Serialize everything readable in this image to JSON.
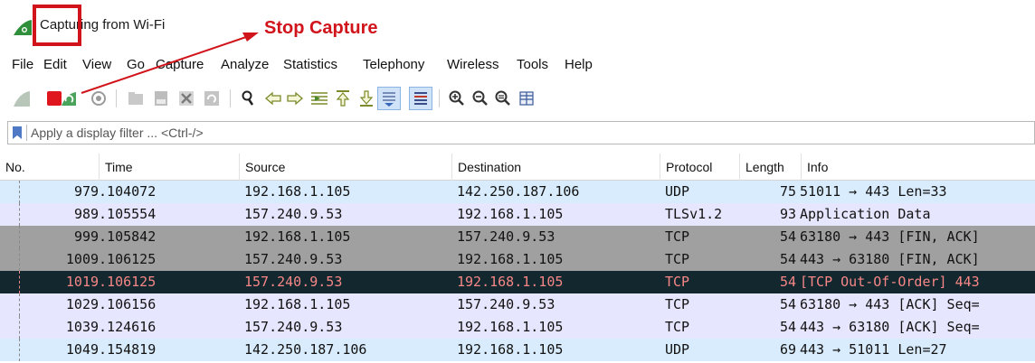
{
  "window": {
    "title": "Capturing from Wi-Fi"
  },
  "annotation": {
    "label": "Stop Capture",
    "color": "#d1141b"
  },
  "menu": [
    "File",
    "Edit",
    "View",
    "Go",
    "Capture",
    "Analyze",
    "Statistics",
    "Telephony",
    "Wireless",
    "Tools",
    "Help"
  ],
  "toolbar": {
    "icons": [
      "start-capture-icon",
      "stop-capture-icon",
      "restart-capture-icon",
      "capture-options-icon",
      "open-file-icon",
      "save-file-icon",
      "close-file-icon",
      "reload-file-icon",
      "find-packet-icon",
      "go-back-icon",
      "go-forward-icon",
      "go-to-packet-icon",
      "first-packet-icon",
      "last-packet-icon",
      "autoscroll-icon",
      "colorize-icon",
      "zoom-in-icon",
      "zoom-out-icon",
      "normal-size-icon",
      "resize-columns-icon"
    ]
  },
  "filter": {
    "placeholder": "Apply a display filter ... <Ctrl-/>",
    "value": ""
  },
  "columns": [
    "No.",
    "Time",
    "Source",
    "Destination",
    "Protocol",
    "Length",
    "Info"
  ],
  "packets": [
    {
      "no": "97",
      "time": "9.104072",
      "source": "192.168.1.105",
      "destination": "142.250.187.106",
      "protocol": "UDP",
      "length": "75",
      "info": "51011 → 443 Len=33",
      "style": "udp"
    },
    {
      "no": "98",
      "time": "9.105554",
      "source": "157.240.9.53",
      "destination": "192.168.1.105",
      "protocol": "TLSv1.2",
      "length": "93",
      "info": "Application Data",
      "style": "tls"
    },
    {
      "no": "99",
      "time": "9.105842",
      "source": "192.168.1.105",
      "destination": "157.240.9.53",
      "protocol": "TCP",
      "length": "54",
      "info": "63180 → 443 [FIN, ACK]",
      "style": "finack"
    },
    {
      "no": "100",
      "time": "9.106125",
      "source": "157.240.9.53",
      "destination": "192.168.1.105",
      "protocol": "TCP",
      "length": "54",
      "info": "443 → 63180 [FIN, ACK]",
      "style": "finack"
    },
    {
      "no": "101",
      "time": "9.106125",
      "source": "157.240.9.53",
      "destination": "192.168.1.105",
      "protocol": "TCP",
      "length": "54",
      "info": "[TCP Out-Of-Order] 443",
      "style": "bad"
    },
    {
      "no": "102",
      "time": "9.106156",
      "source": "192.168.1.105",
      "destination": "157.240.9.53",
      "protocol": "TCP",
      "length": "54",
      "info": "63180 → 443 [ACK] Seq=",
      "style": "tcp"
    },
    {
      "no": "103",
      "time": "9.124616",
      "source": "157.240.9.53",
      "destination": "192.168.1.105",
      "protocol": "TCP",
      "length": "54",
      "info": "443 → 63180 [ACK] Seq=",
      "style": "tcp"
    },
    {
      "no": "104",
      "time": "9.154819",
      "source": "142.250.187.106",
      "destination": "192.168.1.105",
      "protocol": "UDP",
      "length": "69",
      "info": "443 → 51011 Len=27",
      "style": "udp"
    }
  ]
}
